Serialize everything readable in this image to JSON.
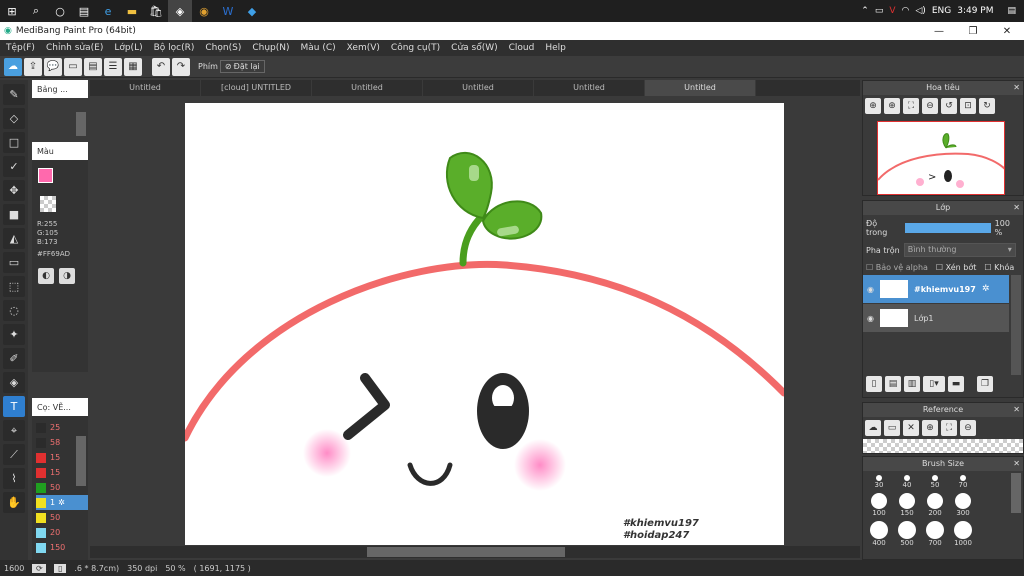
{
  "taskbar": {
    "time": "3:49 PM",
    "lang": "ENG"
  },
  "window": {
    "title": "MediBang Paint Pro (64bit)",
    "min": "—",
    "max": "❐",
    "close": "✕"
  },
  "menu": [
    "Tệp(F)",
    "Chỉnh sửa(E)",
    "Lớp(L)",
    "Bộ lọc(R)",
    "Chọn(S)",
    "Chụp(N)",
    "Màu (C)",
    "Xem(V)",
    "Công cụ(T)",
    "Cửa sổ(W)",
    "Cloud",
    "Help"
  ],
  "toolbar": {
    "phim_label": "Phím",
    "reset_label": "Đặt lại"
  },
  "tabs": [
    "Untitled",
    "[cloud] UNTITLED",
    "Untitled",
    "Untitled",
    "Untitled",
    "Untitled"
  ],
  "left_panels": {
    "brush_title": "Bảng ...",
    "color_title": "Màu",
    "rgb": {
      "r": "R:255",
      "g": "G:105",
      "b": "B:173"
    },
    "hex": "#FF69AD",
    "brushsize_title": "Cọ: VẼ...",
    "sizes": [
      {
        "value": "25",
        "color": "#2b2b2b"
      },
      {
        "value": "58",
        "color": "#2b2b2b"
      },
      {
        "value": "15",
        "color": "#e03030"
      },
      {
        "value": "15",
        "color": "#e03030"
      },
      {
        "value": "50",
        "color": "#20a020"
      },
      {
        "value": "1",
        "color": "#f0e020"
      },
      {
        "value": "50",
        "color": "#f0e020"
      },
      {
        "value": "20",
        "color": "#80d8f0"
      },
      {
        "value": "150",
        "color": "#80d8f0"
      }
    ]
  },
  "canvas": {
    "watermark1": "#khiemvu197",
    "watermark2": "#hoidap247"
  },
  "status": {
    "zoom": "1600",
    "size": ".6 * 8.7cm)",
    "dpi": "350 dpi",
    "percent": "50 %",
    "coords": "( 1691, 1175 )"
  },
  "navigator": {
    "title": "Hoa tiêu"
  },
  "layers": {
    "title": "Lớp",
    "opacity_label": "Độ trong",
    "opacity_value": "100 %",
    "opacity": 1.0,
    "blend_label": "Pha trộn",
    "blend_value": "Bình thường",
    "protect_alpha": "Bảo vệ alpha",
    "clip": "Xén bớt",
    "lock": "Khóa",
    "items": [
      {
        "name": "#khiemvu197"
      },
      {
        "name": "Lớp1"
      }
    ]
  },
  "reference": {
    "title": "Reference"
  },
  "brushsize": {
    "title": "Brush Size",
    "sizes": [
      "30",
      "40",
      "50",
      "70",
      "100",
      "150",
      "200",
      "300",
      "400",
      "500",
      "700",
      "1000"
    ]
  }
}
